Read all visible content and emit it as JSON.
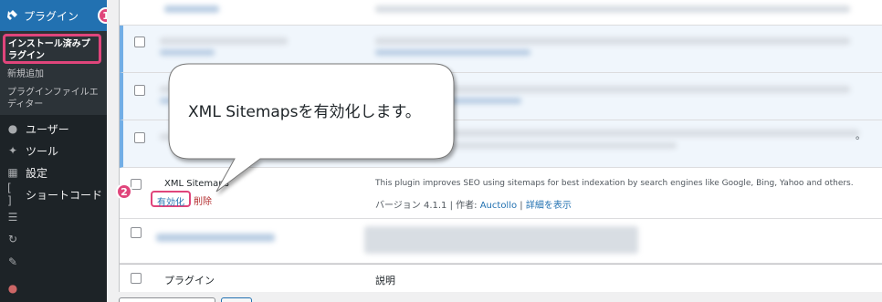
{
  "sidebar": {
    "plugins_label": "プラグイン",
    "sub_installed": "インストール済みプラグイン",
    "sub_add_new": "新規追加",
    "sub_editor": "プラグインファイルエディター",
    "items": [
      {
        "label": "ユーザー",
        "icon": "user-icon"
      },
      {
        "label": "ツール",
        "icon": "wrench-icon"
      },
      {
        "label": "設定",
        "icon": "settings-icon"
      },
      {
        "label": "ショートコード",
        "icon": "brackets-icon"
      }
    ],
    "extra_icons": [
      "list-icon",
      "refresh-icon",
      "edit-icon",
      "plugin-icon"
    ]
  },
  "badges": {
    "one": "1",
    "two": "2"
  },
  "callout": {
    "text": "XML Sitemapsを有効化します。"
  },
  "plugin": {
    "name": "XML Sitemaps",
    "activate": "有効化",
    "delete": "削除",
    "description": "This plugin improves SEO using sitemaps for best indexation by search engines like Google, Bing, Yahoo and others.",
    "version": "バージョン 4.1.1",
    "separator1": " | 作者: ",
    "author": "Auctollo",
    "separator2": " | ",
    "details": "詳細を表示"
  },
  "footer": {
    "plugin_header": "プラグイン",
    "desc_header": "説明"
  },
  "trail": "。",
  "colors": {
    "accent": "#e0457b",
    "link": "#2271b1",
    "sidebar": "#1d2327"
  }
}
